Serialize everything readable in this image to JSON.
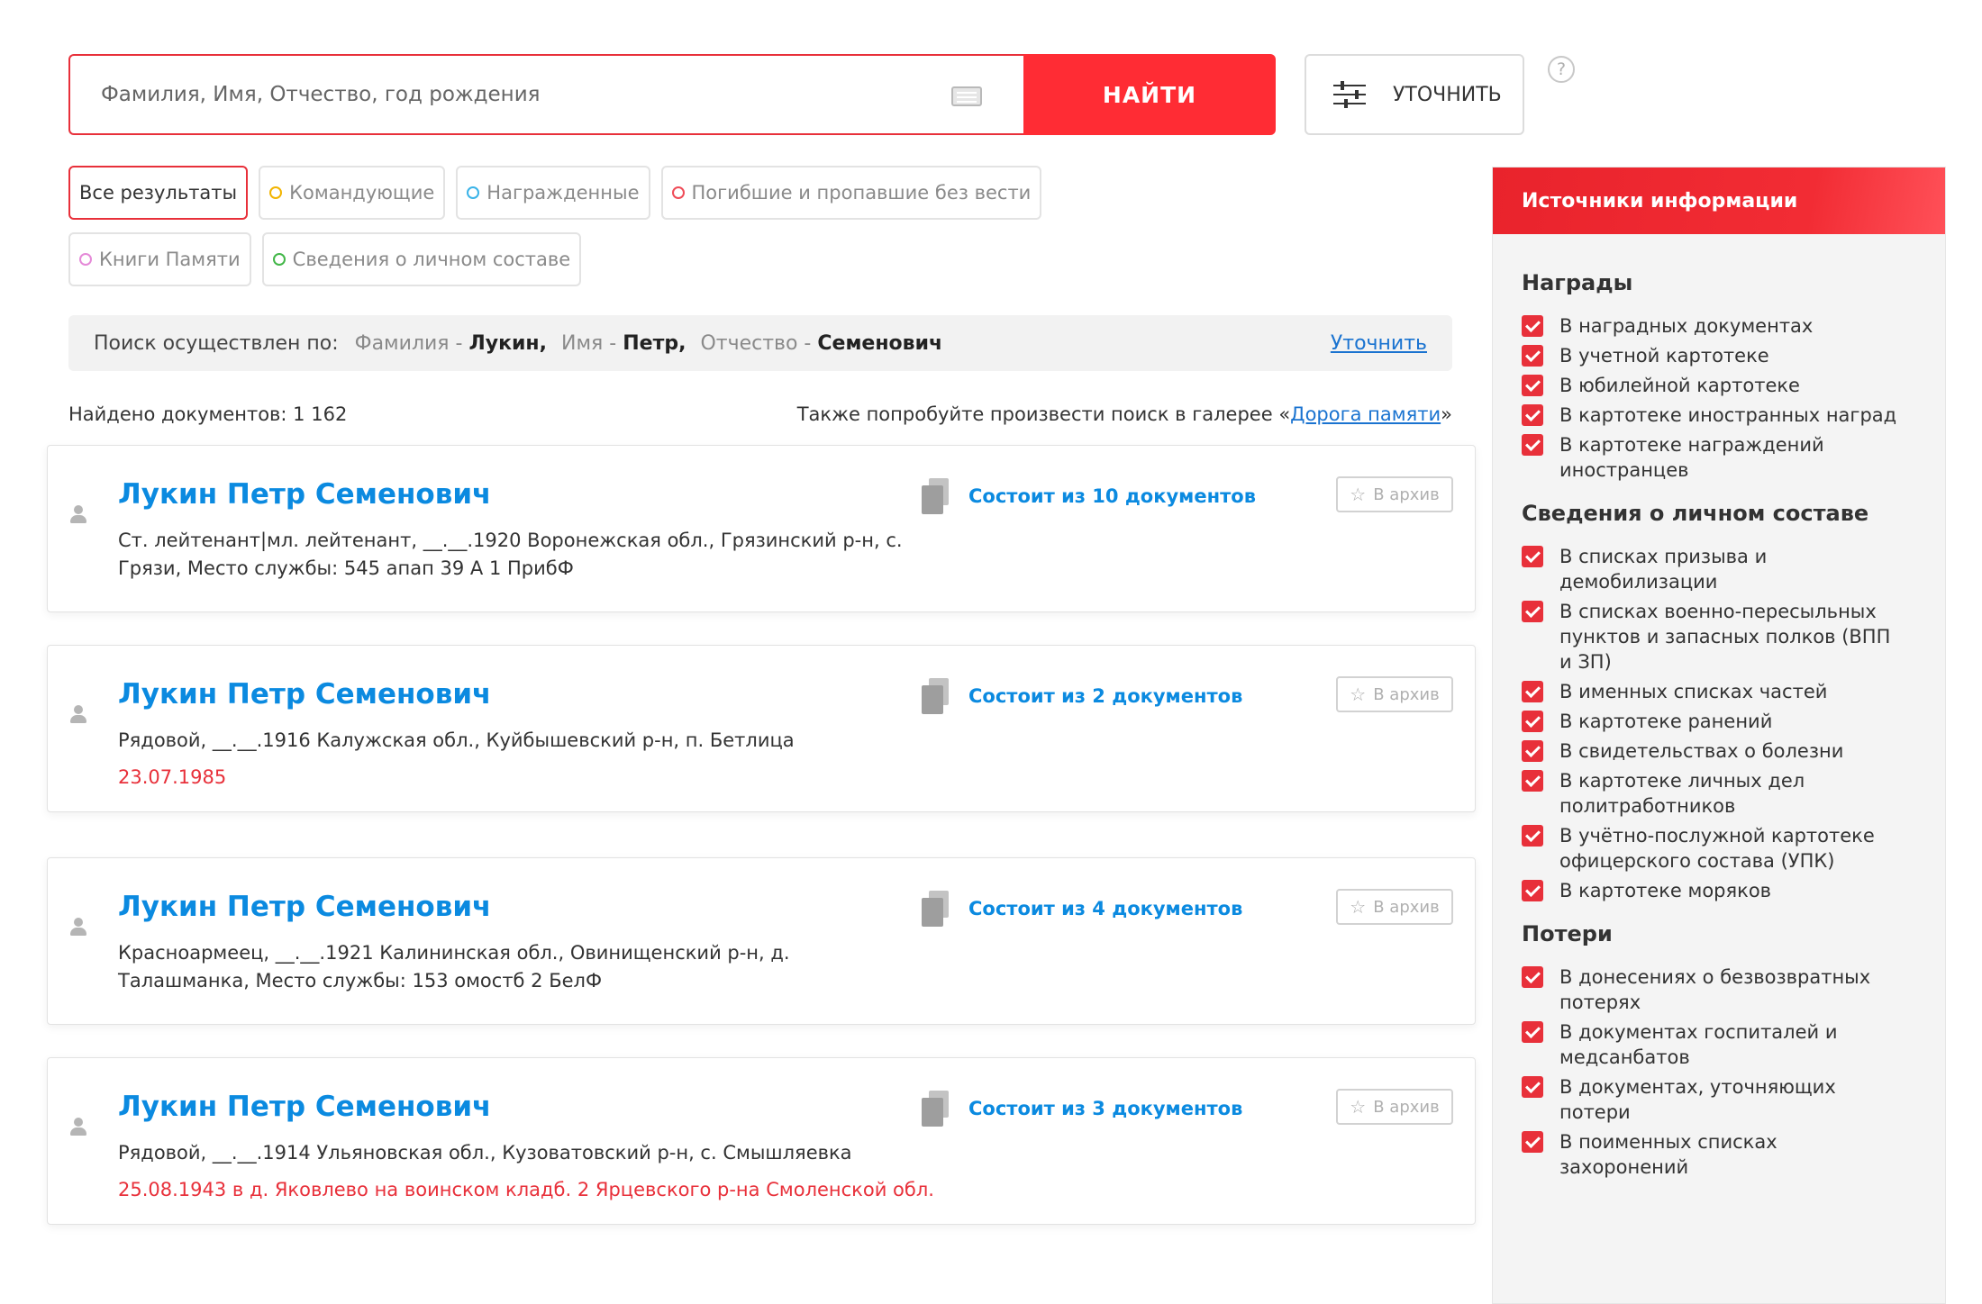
{
  "search": {
    "placeholder": "Фамилия, Имя, Отчество, год рождения",
    "button": "НАЙТИ",
    "refine": "УТОЧНИТЬ",
    "help": "?"
  },
  "filters": [
    {
      "label": "Все результаты",
      "active": true,
      "color": ""
    },
    {
      "label": "Командующие",
      "active": false,
      "color": "#f2b400"
    },
    {
      "label": "Награжденные",
      "active": false,
      "color": "#3ab3e8"
    },
    {
      "label": "Погибшие и пропавшие без вести",
      "active": false,
      "color": "#ef4b57"
    },
    {
      "label": "Книги Памяти",
      "active": false,
      "color": "#e58ad8"
    },
    {
      "label": "Сведения о личном составе",
      "active": false,
      "color": "#43b749"
    }
  ],
  "query": {
    "label": "Поиск осуществлен по:",
    "surname_key": "Фамилия -",
    "surname": "Лукин,",
    "name_key": "Имя -",
    "name": "Петр,",
    "patronymic_key": "Отчество -",
    "patronymic": "Семенович",
    "refine_link": "Уточнить"
  },
  "results_info": {
    "found": "Найдено документов: 1 162",
    "also_prefix": "Также попробуйте произвести поиск в галерее «",
    "also_link": "Дорога памяти",
    "also_suffix": "»"
  },
  "results": [
    {
      "name": "Лукин Петр Семенович",
      "desc": "Ст. лейтенант|мл. лейтенант, __.__.1920 Воронежская обл., Грязинский р-н, с. Грязи, Место службы: 545 апап 39 А 1 ПрибФ",
      "date": "",
      "docs": "Состоит из 10 документов",
      "archive": "В архив"
    },
    {
      "name": "Лукин Петр Семенович",
      "desc": "Рядовой, __.__.1916 Калужская обл., Куйбышевский р-н, п. Бетлица",
      "date": "23.07.1985",
      "docs": "Состоит из 2 документов",
      "archive": "В архив"
    },
    {
      "name": "Лукин Петр Семенович",
      "desc": "Красноармеец, __.__.1921 Калининская обл., Овинищенский р-н, д. Талашманка, Место службы: 153 омостб 2 БелФ",
      "date": "",
      "docs": "Состоит из 4 документов",
      "archive": "В архив"
    },
    {
      "name": "Лукин Петр Семенович",
      "desc": "Рядовой, __.__.1914 Ульяновская обл., Кузоватовский р-н, с. Смышляевка",
      "date": "25.08.1943 в д. Яковлево на воинском кладб. 2 Ярцевского р-на Смоленской обл.",
      "docs": "Состоит из 3 документов",
      "archive": "В архив"
    }
  ],
  "sidebar": {
    "title": "Источники информации",
    "groups": [
      {
        "title": "Награды",
        "items": [
          "В наградных документах",
          "В учетной картотеке",
          "В юбилейной картотеке",
          "В картотеке иностранных наград",
          "В картотеке награждений иностранцев"
        ]
      },
      {
        "title": "Сведения о личном составе",
        "items": [
          "В списках призыва и демобилизации",
          "В списках военно-пересыльных пунктов и запасных полков (ВПП и ЗП)",
          "В именных списках частей",
          "В картотеке ранений",
          "В свидетельствах о болезни",
          "В картотеке личных дел политработников",
          "В учётно-послужной картотеке офицерского состава (УПК)",
          "В картотеке моряков"
        ]
      },
      {
        "title": "Потери",
        "items": [
          "В донесениях о безвозвратных потерях",
          "В документах госпиталей и медсанбатов",
          "В документах, уточняющих потери",
          "В поименных списках захоронений"
        ]
      }
    ]
  }
}
